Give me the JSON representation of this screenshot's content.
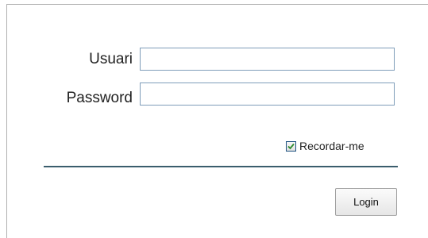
{
  "form": {
    "username_label": "Usuari",
    "username_value": "",
    "password_label": "Password",
    "password_value": "",
    "remember_label": "Recordar-me",
    "remember_checked": true,
    "login_label": "Login"
  },
  "icons": {
    "checkbox_check": "checkmark-icon"
  },
  "colors": {
    "check_mark": "#2e8b2e",
    "divider": "#3b5d6d",
    "field_border": "#7f9db9"
  }
}
